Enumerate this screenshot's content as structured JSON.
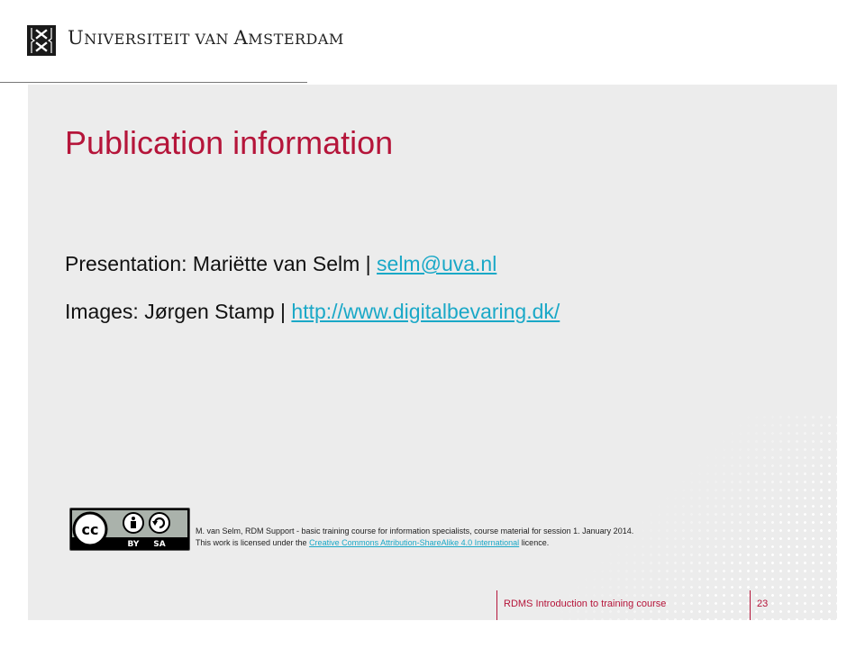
{
  "header": {
    "university_name_parts": [
      {
        "text": "U",
        "size": "big"
      },
      {
        "text": "NIVERSITEIT VAN ",
        "size": "small"
      },
      {
        "text": "A",
        "size": "big"
      },
      {
        "text": "MSTERDAM",
        "size": "small"
      }
    ],
    "logo_icon": "uva-crosses-logo-icon"
  },
  "slide": {
    "title": "Publication information",
    "presentation_label": "Presentation: Mariëtte van Selm | ",
    "presentation_email": "selm@uva.nl",
    "images_label": "Images: Jørgen Stamp | ",
    "images_url": "http://www.digitalbevaring.dk/"
  },
  "license": {
    "badge_icon": "cc-by-sa-badge-icon",
    "badge_by": "BY",
    "badge_sa": "SA",
    "line1": "M. van Selm, RDM Support - basic training course for information specialists, course material for session 1. January 2014.",
    "line2_prefix": "This work is licensed under the ",
    "line2_link": "Creative Commons Attribution-ShareAlike 4.0 International",
    "line2_suffix": " licence."
  },
  "footer": {
    "course_title": "RDMS Introduction to training course",
    "page_number": "23"
  },
  "colors": {
    "accent": "#b5153a",
    "link": "#1aa8c7",
    "panel_bg": "#ececec"
  }
}
